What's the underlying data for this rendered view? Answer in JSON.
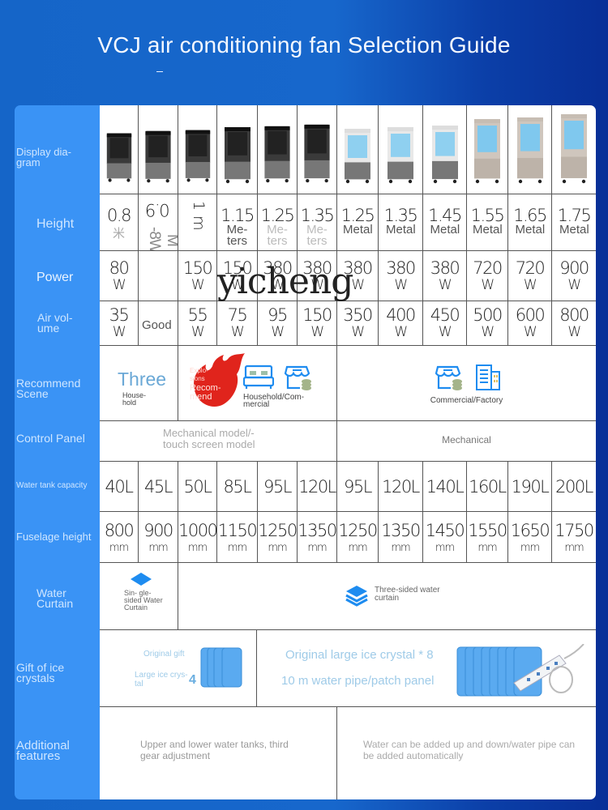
{
  "title": "VCJ air conditioning fan Selection Guide",
  "watermark": "yicheng",
  "row_labels": {
    "display": "Display dia- gram",
    "height": "Height",
    "power": "Power",
    "air_volume": "Air vol- ume",
    "scene": "Recommend Scene",
    "control": "Control Panel",
    "tank": "Water tank capacity",
    "fuselage": "Fuselage height",
    "curtain": "Water Curtain",
    "gift": "Gift of ice crystals",
    "features": "Additional features"
  },
  "models": [
    {
      "style": "black",
      "height_num": "0.8",
      "height_unit": "米",
      "power_num": "80",
      "power_unit": "W",
      "air_num": "35",
      "air_unit": "W",
      "tank": "40L",
      "fuselage": "800",
      "fuselage_unit": "mm"
    },
    {
      "style": "black",
      "height_num": "0.9",
      "height_unit": "M -8W",
      "power_num": "",
      "power_unit": "",
      "air_num": "Good",
      "air_unit": "",
      "tank": "45L",
      "fuselage": "900",
      "fuselage_unit": "mm"
    },
    {
      "style": "black",
      "height_num": "1 m",
      "height_unit": "",
      "power_num": "150",
      "power_unit": "W",
      "air_num": "55",
      "air_unit": "W",
      "tank": "50L",
      "fuselage": "1000",
      "fuselage_unit": "mm"
    },
    {
      "style": "black",
      "height_num": "1.15",
      "height_unit": "Me- ters",
      "power_num": "150",
      "power_unit": "W",
      "air_num": "75",
      "air_unit": "W",
      "tank": "85L",
      "fuselage": "1150",
      "fuselage_unit": "mm"
    },
    {
      "style": "black",
      "height_num": "1.25",
      "height_unit": "Me- ters",
      "power_num": "380",
      "power_unit": "W",
      "air_num": "95",
      "air_unit": "W",
      "tank": "95L",
      "fuselage": "1250",
      "fuselage_unit": "mm"
    },
    {
      "style": "black",
      "height_num": "1.35",
      "height_unit": "Me- ters",
      "power_num": "380",
      "power_unit": "W",
      "air_num": "150",
      "air_unit": "W",
      "tank": "120L",
      "fuselage": "1350",
      "fuselage_unit": "mm"
    },
    {
      "style": "white",
      "height_num": "1.25",
      "height_unit": "Metal",
      "power_num": "380",
      "power_unit": "W",
      "air_num": "350",
      "air_unit": "W",
      "tank": "95L",
      "fuselage": "1250",
      "fuselage_unit": "mm"
    },
    {
      "style": "white",
      "height_num": "1.35",
      "height_unit": "Metal",
      "power_num": "380",
      "power_unit": "W",
      "air_num": "400",
      "air_unit": "W",
      "tank": "120L",
      "fuselage": "1350",
      "fuselage_unit": "mm"
    },
    {
      "style": "white",
      "height_num": "1.45",
      "height_unit": "Metal",
      "power_num": "380",
      "power_unit": "W",
      "air_num": "450",
      "air_unit": "W",
      "tank": "140L",
      "fuselage": "1450",
      "fuselage_unit": "mm"
    },
    {
      "style": "beige",
      "height_num": "1.55",
      "height_unit": "Metal",
      "power_num": "720",
      "power_unit": "W",
      "air_num": "500",
      "air_unit": "W",
      "tank": "160L",
      "fuselage": "1550",
      "fuselage_unit": "mm"
    },
    {
      "style": "beige",
      "height_num": "1.65",
      "height_unit": "Metal",
      "power_num": "720",
      "power_unit": "W",
      "air_num": "600",
      "air_unit": "W",
      "tank": "190L",
      "fuselage": "1650",
      "fuselage_unit": "mm"
    },
    {
      "style": "beige",
      "height_num": "1.75",
      "height_unit": "Metal",
      "power_num": "900",
      "power_unit": "W",
      "air_num": "800",
      "air_unit": "W",
      "tank": "200L",
      "fuselage": "1750",
      "fuselage_unit": "mm"
    }
  ],
  "scene": {
    "three": "Three",
    "household": "House- hold",
    "badge_small": "Explo- sions",
    "badge_big": "Recom- mend",
    "household_commercial": "Household/Com- mercial",
    "commercial_factory": "Commercial/Factory"
  },
  "control": {
    "left": "Mechanical model/- touch screen model",
    "right": "Mechanical"
  },
  "curtain": {
    "single": "Sin- gle-sided Water Curtain",
    "three": "Three-sided water curtain"
  },
  "gift": {
    "original_gift": "Original gift",
    "large_ice": "Large ice crys- tal",
    "count_small": "4",
    "right_line1": "Original large ice crystal * 8",
    "right_line2": "10 m water pipe/patch panel"
  },
  "features": {
    "left": "Upper and lower water tanks, third gear adjustment",
    "right": "Water can be added up and down/water pipe can be added automatically"
  },
  "colors": {
    "accent_blue": "#3a93f5",
    "icon_blue": "#1e8cf0",
    "fire_red": "#e0241c"
  }
}
